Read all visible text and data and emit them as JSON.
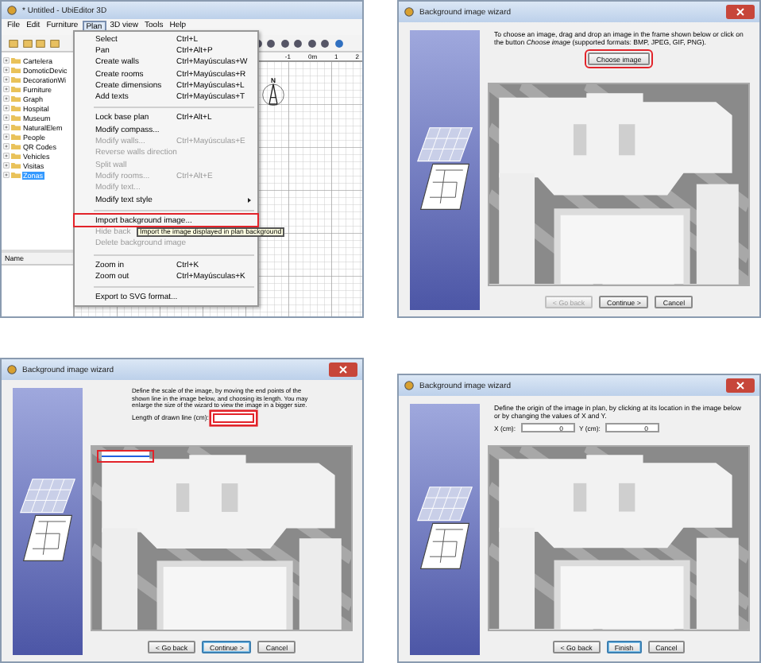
{
  "main_window": {
    "title": "* Untitled - UbiEditor 3D",
    "menubar": [
      {
        "label": "File",
        "selected": false
      },
      {
        "label": "Edit",
        "selected": false
      },
      {
        "label": "Furniture",
        "selected": false
      },
      {
        "label": "Plan",
        "selected": true
      },
      {
        "label": "3D view",
        "selected": false
      },
      {
        "label": "Tools",
        "selected": false
      },
      {
        "label": "Help",
        "selected": false
      }
    ],
    "tree": [
      {
        "label": "Cartelera",
        "selected": false
      },
      {
        "label": "DomoticDevic",
        "selected": false
      },
      {
        "label": "DecorationWi",
        "selected": false
      },
      {
        "label": "Furniture",
        "selected": false
      },
      {
        "label": "Graph",
        "selected": false
      },
      {
        "label": "Hospital",
        "selected": false
      },
      {
        "label": "Museum",
        "selected": false
      },
      {
        "label": "NaturalElem",
        "selected": false
      },
      {
        "label": "People",
        "selected": false
      },
      {
        "label": "QR Codes",
        "selected": false
      },
      {
        "label": "Vehicles",
        "selected": false
      },
      {
        "label": "Visitas",
        "selected": false
      },
      {
        "label": "Zonas",
        "selected": true
      }
    ],
    "furniture_columns": [
      "Name"
    ],
    "ruler": [
      "-1",
      "0m",
      "1",
      "2"
    ],
    "compass_label": "N",
    "menu": [
      {
        "kind": "item",
        "label": "Select",
        "shortcut": "Ctrl+L",
        "disabled": false,
        "highlighted": false
      },
      {
        "kind": "item",
        "label": "Pan",
        "shortcut": "Ctrl+Alt+P",
        "disabled": false,
        "highlighted": false
      },
      {
        "kind": "item",
        "label": "Create walls",
        "shortcut": "Ctrl+Mayúsculas+W",
        "disabled": false,
        "highlighted": false
      },
      {
        "kind": "item",
        "label": "Create rooms",
        "shortcut": "Ctrl+Mayúsculas+R",
        "disabled": false,
        "highlighted": false
      },
      {
        "kind": "item",
        "label": "Create dimensions",
        "shortcut": "Ctrl+Mayúsculas+L",
        "disabled": false,
        "highlighted": false
      },
      {
        "kind": "item",
        "label": "Add texts",
        "shortcut": "Ctrl+Mayúsculas+T",
        "disabled": false,
        "highlighted": false
      },
      {
        "kind": "separator"
      },
      {
        "kind": "item",
        "label": "Lock base plan",
        "shortcut": "Ctrl+Alt+L",
        "disabled": false,
        "highlighted": false
      },
      {
        "kind": "item",
        "label": "Modify compass...",
        "disabled": false,
        "highlighted": false
      },
      {
        "kind": "item",
        "label": "Modify walls...",
        "shortcut": "Ctrl+Mayúsculas+E",
        "disabled": true,
        "highlighted": false
      },
      {
        "kind": "item",
        "label": "Reverse walls direction",
        "disabled": true,
        "highlighted": false
      },
      {
        "kind": "item",
        "label": "Split wall",
        "disabled": true,
        "highlighted": false
      },
      {
        "kind": "item",
        "label": "Modify rooms...",
        "shortcut": "Ctrl+Alt+E",
        "disabled": true,
        "highlighted": false
      },
      {
        "kind": "item",
        "label": "Modify text...",
        "disabled": true,
        "highlighted": false
      },
      {
        "kind": "submenu",
        "label": "Modify text style",
        "disabled": false,
        "highlighted": false
      },
      {
        "kind": "separator"
      },
      {
        "kind": "item",
        "label": "Import background image...",
        "disabled": false,
        "highlighted": true
      },
      {
        "kind": "item",
        "label": "Hide back",
        "disabled": true,
        "highlighted": false
      },
      {
        "kind": "item",
        "label": "Delete background image",
        "disabled": true,
        "highlighted": false
      },
      {
        "kind": "separator"
      },
      {
        "kind": "item",
        "label": "Zoom in",
        "shortcut": "Ctrl+K",
        "disabled": false,
        "highlighted": false
      },
      {
        "kind": "item",
        "label": "Zoom out",
        "shortcut": "Ctrl+Mayúsculas+K",
        "disabled": false,
        "highlighted": false
      },
      {
        "kind": "separator"
      },
      {
        "kind": "item",
        "label": "Export to SVG format...",
        "disabled": false,
        "highlighted": false
      }
    ],
    "tooltip": "Import the image displayed in plan background"
  },
  "wizards": [
    {
      "kind": "choose",
      "title": "Background image wizard",
      "instructions": "To choose an image, drag and drop an image in the frame shown below or click on the button *Choose image* (supported formats: BMP, JPEG, GIF, PNG).",
      "choose_button": {
        "label": "Choose image",
        "highlighted": true
      },
      "buttons": [
        {
          "label": "< Go back",
          "disabled": true,
          "default": false
        },
        {
          "label": "Continue >",
          "disabled": false,
          "default": false
        },
        {
          "label": "Cancel",
          "disabled": false,
          "default": false
        }
      ]
    },
    {
      "kind": "scale",
      "title": "Background image wizard",
      "instructions": "Define the scale of the image, by moving the end points of the shown line in the image below, and choosing its length. You may enlarge the size of the wizard to view the image in a bigger size.",
      "length_label": "Length of drawn line (cm):",
      "length_highlighted": true,
      "line_highlighted": true,
      "buttons": [
        {
          "label": "< Go back",
          "disabled": false,
          "default": false
        },
        {
          "label": "Continue >",
          "disabled": false,
          "default": true
        },
        {
          "label": "Cancel",
          "disabled": false,
          "default": false
        }
      ]
    },
    {
      "kind": "origin",
      "title": "Background image wizard",
      "instructions": "Define the origin of the image in plan, by clicking at its location in the image below or by changing the values of X and Y.",
      "fields": [
        {
          "label": "X (cm):",
          "value": "0"
        },
        {
          "label": "Y (cm):",
          "value": "0"
        }
      ],
      "buttons": [
        {
          "label": "< Go back",
          "disabled": false,
          "default": false
        },
        {
          "label": "Finish",
          "disabled": false,
          "default": true
        },
        {
          "label": "Cancel",
          "disabled": false,
          "default": false
        }
      ]
    }
  ]
}
